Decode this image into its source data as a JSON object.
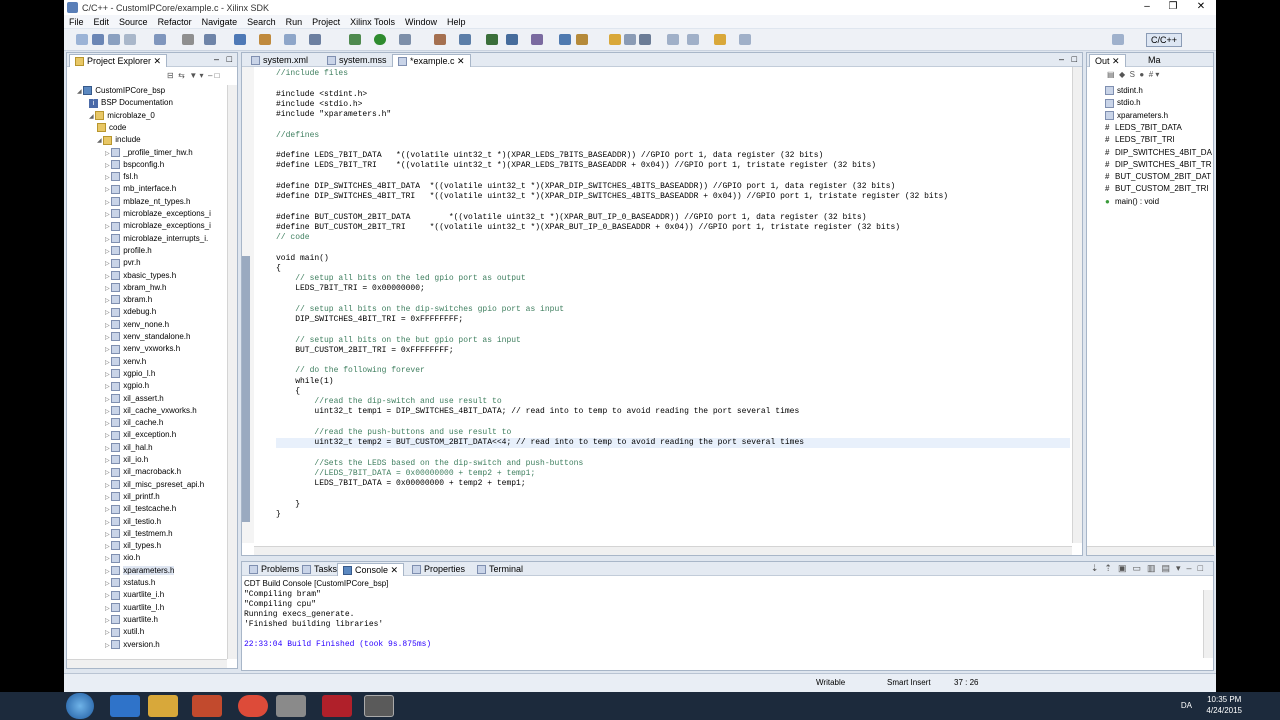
{
  "window": {
    "title": "C/C++ - CustomIPCore/example.c - Xilinx SDK"
  },
  "menu": [
    "File",
    "Edit",
    "Source",
    "Refactor",
    "Navigate",
    "Search",
    "Run",
    "Project",
    "Xilinx Tools",
    "Window",
    "Help"
  ],
  "perspective": "C/C++",
  "explorer": {
    "tab": "Project Explorer",
    "items": [
      {
        "label": "CustomIPCore_bsp",
        "icon": "project-icon"
      },
      {
        "label": "BSP Documentation",
        "icon": "info-icon"
      },
      {
        "label": "microblaze_0",
        "icon": "folder-icon"
      },
      {
        "label": "code",
        "icon": "folder-icon"
      },
      {
        "label": "include",
        "icon": "folder-icon"
      },
      {
        "label": "_profile_timer_hw.h",
        "icon": "header-icon"
      },
      {
        "label": "bspconfig.h",
        "icon": "header-icon"
      },
      {
        "label": "fsl.h",
        "icon": "header-icon"
      },
      {
        "label": "mb_interface.h",
        "icon": "header-icon"
      },
      {
        "label": "mblaze_nt_types.h",
        "icon": "header-icon"
      },
      {
        "label": "microblaze_exceptions_i",
        "icon": "header-icon"
      },
      {
        "label": "microblaze_exceptions_i",
        "icon": "header-icon"
      },
      {
        "label": "microblaze_interrupts_i.",
        "icon": "header-icon"
      },
      {
        "label": "profile.h",
        "icon": "header-icon"
      },
      {
        "label": "pvr.h",
        "icon": "header-icon"
      },
      {
        "label": "xbasic_types.h",
        "icon": "header-icon"
      },
      {
        "label": "xbram_hw.h",
        "icon": "header-icon"
      },
      {
        "label": "xbram.h",
        "icon": "header-icon"
      },
      {
        "label": "xdebug.h",
        "icon": "header-icon"
      },
      {
        "label": "xenv_none.h",
        "icon": "header-icon"
      },
      {
        "label": "xenv_standalone.h",
        "icon": "header-icon"
      },
      {
        "label": "xenv_vxworks.h",
        "icon": "header-icon"
      },
      {
        "label": "xenv.h",
        "icon": "header-icon"
      },
      {
        "label": "xgpio_l.h",
        "icon": "header-icon"
      },
      {
        "label": "xgpio.h",
        "icon": "header-icon"
      },
      {
        "label": "xil_assert.h",
        "icon": "header-icon"
      },
      {
        "label": "xil_cache_vxworks.h",
        "icon": "header-icon"
      },
      {
        "label": "xil_cache.h",
        "icon": "header-icon"
      },
      {
        "label": "xil_exception.h",
        "icon": "header-icon"
      },
      {
        "label": "xil_hal.h",
        "icon": "header-icon"
      },
      {
        "label": "xil_io.h",
        "icon": "header-icon"
      },
      {
        "label": "xil_macroback.h",
        "icon": "header-icon"
      },
      {
        "label": "xil_misc_psreset_api.h",
        "icon": "header-icon"
      },
      {
        "label": "xil_printf.h",
        "icon": "header-icon"
      },
      {
        "label": "xil_testcache.h",
        "icon": "header-icon"
      },
      {
        "label": "xil_testio.h",
        "icon": "header-icon"
      },
      {
        "label": "xil_testmem.h",
        "icon": "header-icon"
      },
      {
        "label": "xil_types.h",
        "icon": "header-icon"
      },
      {
        "label": "xio.h",
        "icon": "header-icon"
      },
      {
        "label": "xparameters.h",
        "icon": "header-icon"
      },
      {
        "label": "xstatus.h",
        "icon": "header-icon"
      },
      {
        "label": "xuartlite_i.h",
        "icon": "header-icon"
      },
      {
        "label": "xuartlite_l.h",
        "icon": "header-icon"
      },
      {
        "label": "xuartlite.h",
        "icon": "header-icon"
      },
      {
        "label": "xutil.h",
        "icon": "header-icon"
      },
      {
        "label": "xversion.h",
        "icon": "header-icon"
      }
    ]
  },
  "editor": {
    "tabs": [
      "system.xml",
      "system.mss",
      "*example.c"
    ],
    "lines": [
      "//include files",
      "",
      "#include <stdint.h>",
      "#include <stdio.h>",
      "#include \"xparameters.h\"",
      "",
      "//defines",
      "",
      "#define LEDS_7BIT_DATA   *((volatile uint32_t *)(XPAR_LEDS_7BITS_BASEADDR)) //GPIO port 1, data register (32 bits)",
      "#define LEDS_7BIT_TRI    *((volatile uint32_t *)(XPAR_LEDS_7BITS_BASEADDR + 0x04)) //GPIO port 1, tristate register (32 bits)",
      "",
      "#define DIP_SWITCHES_4BIT_DATA  *((volatile uint32_t *)(XPAR_DIP_SWITCHES_4BITS_BASEADDR)) //GPIO port 1, data register (32 bits)",
      "#define DIP_SWITCHES_4BIT_TRI   *((volatile uint32_t *)(XPAR_DIP_SWITCHES_4BITS_BASEADDR + 0x04)) //GPIO port 1, tristate register (32 bits)",
      "",
      "#define BUT_CUSTOM_2BIT_DATA        *((volatile uint32_t *)(XPAR_BUT_IP_0_BASEADDR)) //GPIO port 1, data register (32 bits)",
      "#define BUT_CUSTOM_2BIT_TRI     *((volatile uint32_t *)(XPAR_BUT_IP_0_BASEADDR + 0x04)) //GPIO port 1, tristate register (32 bits)",
      "// code",
      "",
      "void main()",
      "{",
      "    // setup all bits on the led gpio port as output",
      "    LEDS_7BIT_TRI = 0x00000000;",
      "",
      "    // setup all bits on the dip-switches gpio port as input",
      "    DIP_SWITCHES_4BIT_TRI = 0xFFFFFFFF;",
      "",
      "    // setup all bits on the but gpio port as input",
      "    BUT_CUSTOM_2BIT_TRI = 0xFFFFFFFF;",
      "",
      "    // do the following forever",
      "    while(1)",
      "    {",
      "        //read the dip-switch and use result to",
      "        uint32_t temp1 = DIP_SWITCHES_4BIT_DATA; // read into to temp to avoid reading the port several times",
      "",
      "        //read the push-buttons and use result to",
      "        uint32_t temp2 = BUT_CUSTOM_2BIT_DATA<<4; // read into to temp to avoid reading the port several times",
      "",
      "        //Sets the LEDS based on the dip-switch and push-buttons",
      "        //LEDS_7BIT_DATA = 0x00000000 + temp2 + temp1;",
      "        LEDS_7BIT_DATA = 0x00000000 + temp2 + temp1;",
      "",
      "    }",
      "}"
    ]
  },
  "outline": {
    "tabs": [
      "Out",
      "Ma"
    ],
    "items": [
      "stdint.h",
      "stdio.h",
      "xparameters.h",
      "LEDS_7BIT_DATA",
      "LEDS_7BIT_TRI",
      "DIP_SWITCHES_4BIT_DA",
      "DIP_SWITCHES_4BIT_TR",
      "BUT_CUSTOM_2BIT_DAT",
      "BUT_CUSTOM_2BIT_TRI",
      "main() : void"
    ]
  },
  "console": {
    "tabs": [
      "Problems",
      "Tasks",
      "Console",
      "Properties",
      "Terminal"
    ],
    "header": "CDT Build Console [CustomIPCore_bsp]",
    "lines": [
      "\"Compiling bram\"",
      "\"Compiling cpu\"",
      "Running execs_generate.",
      "'Finished building libraries'",
      "",
      "22:33:04 Build Finished (took 9s.875ms)"
    ]
  },
  "status": {
    "writable": "Writable",
    "insert": "Smart Insert",
    "position": "37 : 26"
  },
  "taskbar": {
    "lang": "DA",
    "time": "10:35 PM",
    "date": "4/24/2015"
  }
}
